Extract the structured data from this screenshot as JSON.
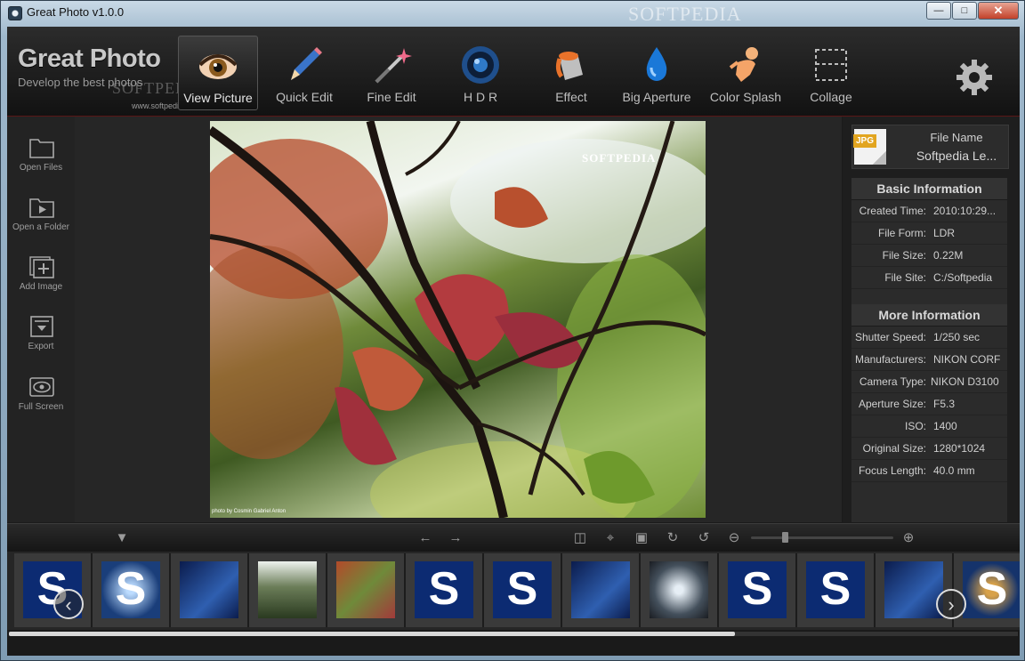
{
  "window": {
    "title": "Great Photo v1.0.0",
    "watermark": "SOFTPEDIA",
    "buttons": [
      "minimize",
      "maximize",
      "close"
    ]
  },
  "brand": {
    "title": "Great Photo",
    "subtitle": "Develop the best photos",
    "watermark": "SOFTPEDIA",
    "url": "www.softpedia.com"
  },
  "toolbar": {
    "tools": [
      {
        "label": "View Picture",
        "icon": "eye-icon",
        "active": true
      },
      {
        "label": "Quick Edit",
        "icon": "pencil-icon"
      },
      {
        "label": "Fine Edit",
        "icon": "magic-wand-icon"
      },
      {
        "label": "H D R",
        "icon": "lens-icon"
      },
      {
        "label": "Effect",
        "icon": "paint-bucket-icon"
      },
      {
        "label": "Big Aperture",
        "icon": "water-drop-icon"
      },
      {
        "label": "Color Splash",
        "icon": "splash-figure-icon"
      },
      {
        "label": "Collage",
        "icon": "collage-icon"
      }
    ],
    "settings_icon": "gear-icon"
  },
  "sidebar": {
    "items": [
      {
        "label": "Open Files",
        "icon": "folder-icon"
      },
      {
        "label": "Open a Folder",
        "icon": "play-folder-icon"
      },
      {
        "label": "Add Image",
        "icon": "add-image-icon"
      },
      {
        "label": "Export",
        "icon": "export-icon"
      },
      {
        "label": "Full Screen",
        "icon": "eye-outline-icon"
      }
    ]
  },
  "viewer": {
    "watermark": "SOFTPEDIA",
    "credit": "photo by Cosmin Gabriel Anton"
  },
  "info": {
    "file_badge": "JPG",
    "file_name_label": "File Name",
    "file_name": "Softpedia Le...",
    "basic_title": "Basic Information",
    "basic": [
      {
        "k": "Created Time:",
        "v": "2010:10:29..."
      },
      {
        "k": "File Form:",
        "v": "LDR"
      },
      {
        "k": "File Size:",
        "v": "0.22M"
      },
      {
        "k": "File Site:",
        "v": "C:/Softpedia"
      }
    ],
    "more_title": "More Information",
    "more": [
      {
        "k": "Shutter Speed:",
        "v": "1/250 sec"
      },
      {
        "k": "Manufacturers:",
        "v": "NIKON CORF"
      },
      {
        "k": "Camera Type:",
        "v": "NIKON D3100"
      },
      {
        "k": "Aperture Size:",
        "v": "F5.3"
      },
      {
        "k": "ISO:",
        "v": "1400"
      },
      {
        "k": "Original Size:",
        "v": "1280*1024"
      },
      {
        "k": "Focus Length:",
        "v": "40.0 mm"
      }
    ]
  },
  "controls": {
    "zoom_level": 0.23,
    "scroll_position": 0.72
  },
  "thumbnails": [
    "s-logo",
    "s-sparkle",
    "blue-abstract",
    "forest",
    "autumn-leaves",
    "s-logo",
    "s-logo",
    "blue-abstract",
    "dark-splash",
    "s-logo",
    "s-logo",
    "blue-abstract",
    "s-swirl"
  ],
  "colors": {
    "accent_red": "#5a1616",
    "background": "#1b1b1b",
    "badge": "#e2a520"
  }
}
